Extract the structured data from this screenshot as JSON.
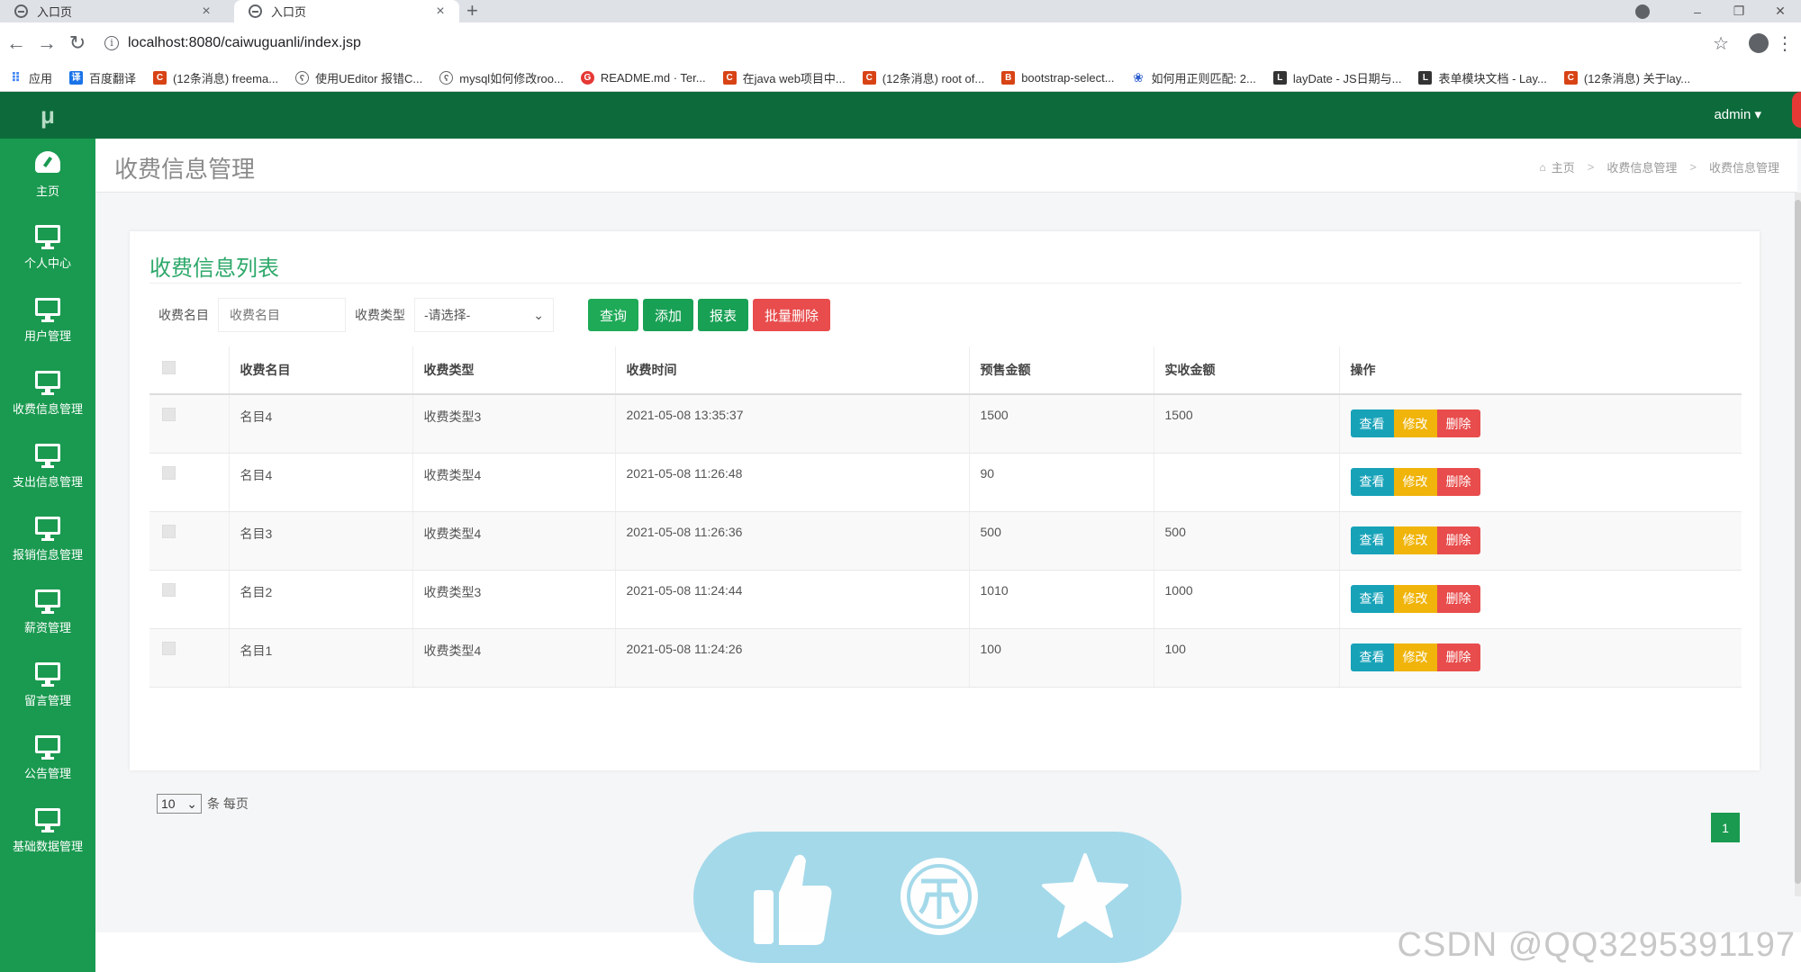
{
  "browser": {
    "tabs": [
      {
        "title": "入口页",
        "active": false
      },
      {
        "title": "入口页",
        "active": true
      }
    ],
    "url": "localhost:8080/caiwuguanli/index.jsp",
    "bookmarks": [
      {
        "icon": "apps-grid-icon",
        "label": "应用"
      },
      {
        "icon": "translate-icon",
        "label": "百度翻译"
      },
      {
        "icon": "csdn-icon",
        "label": "(12条消息) freema..."
      },
      {
        "icon": "bookmark-page-icon",
        "label": "使用UEditor 报错C..."
      },
      {
        "icon": "bookmark-page-icon",
        "label": "mysql如何修改roo..."
      },
      {
        "icon": "gitee-icon",
        "label": "README.md · Ter..."
      },
      {
        "icon": "csdn-icon",
        "label": "在java web项目中..."
      },
      {
        "icon": "csdn-icon",
        "label": "(12条消息) root of..."
      },
      {
        "icon": "bootstrap-icon",
        "label": "bootstrap-select..."
      },
      {
        "icon": "baidu-paw-icon",
        "label": "如何用正则匹配: 2..."
      },
      {
        "icon": "layui-icon",
        "label": "layDate - JS日期与..."
      },
      {
        "icon": "layui-icon",
        "label": "表单模块文档 - Lay..."
      },
      {
        "icon": "csdn-icon",
        "label": "(12条消息) 关于lay..."
      }
    ]
  },
  "app": {
    "logo": "μ",
    "user": "admin",
    "sidebar": [
      {
        "label": "主页",
        "icon": "dashboard-icon"
      },
      {
        "label": "个人中心",
        "icon": "monitor-icon"
      },
      {
        "label": "用户管理",
        "icon": "monitor-icon"
      },
      {
        "label": "收费信息管理",
        "icon": "monitor-icon"
      },
      {
        "label": "支出信息管理",
        "icon": "monitor-icon"
      },
      {
        "label": "报销信息管理",
        "icon": "monitor-icon"
      },
      {
        "label": "薪资管理",
        "icon": "monitor-icon"
      },
      {
        "label": "留言管理",
        "icon": "monitor-icon"
      },
      {
        "label": "公告管理",
        "icon": "monitor-icon"
      },
      {
        "label": "基础数据管理",
        "icon": "monitor-icon"
      }
    ],
    "page_title": "收费信息管理",
    "breadcrumb": [
      "主页",
      "收费信息管理",
      "收费信息管理"
    ],
    "card_title": "收费信息列表",
    "filters": {
      "name_label": "收费名目",
      "name_placeholder": "收费名目",
      "type_label": "收费类型",
      "type_selected": "-请选择-"
    },
    "buttons": {
      "search": "查询",
      "add": "添加",
      "report": "报表",
      "batch_delete": "批量删除"
    },
    "table": {
      "headers": [
        "收费名目",
        "收费类型",
        "收费时间",
        "预售金额",
        "实收金额",
        "操作"
      ],
      "rows": [
        {
          "name": "名目4",
          "type": "收费类型3",
          "time": "2021-05-08 13:35:37",
          "presale": "1500",
          "actual": "1500"
        },
        {
          "name": "名目4",
          "type": "收费类型4",
          "time": "2021-05-08 11:26:48",
          "presale": "90",
          "actual": ""
        },
        {
          "name": "名目3",
          "type": "收费类型4",
          "time": "2021-05-08 11:26:36",
          "presale": "500",
          "actual": "500"
        },
        {
          "name": "名目2",
          "type": "收费类型3",
          "time": "2021-05-08 11:24:44",
          "presale": "1010",
          "actual": "1000"
        },
        {
          "name": "名目1",
          "type": "收费类型4",
          "time": "2021-05-08 11:24:26",
          "presale": "100",
          "actual": "100"
        }
      ],
      "actions": {
        "view": "查看",
        "edit": "修改",
        "delete": "删除"
      }
    },
    "pagination": {
      "page_size": "10",
      "per_page_label": "条 每页",
      "current_page": "1"
    }
  },
  "overlay": {
    "icons": [
      "thumbs-up-icon",
      "coin-icon",
      "star-icon"
    ]
  },
  "watermark": "CSDN @QQ3295391197",
  "colors": {
    "sidebar": "#1a9a50",
    "topbar": "#0d6b3b",
    "accent": "#2da86a",
    "danger": "#e84c4c",
    "warning": "#f0b40a",
    "info": "#17a2b8"
  }
}
